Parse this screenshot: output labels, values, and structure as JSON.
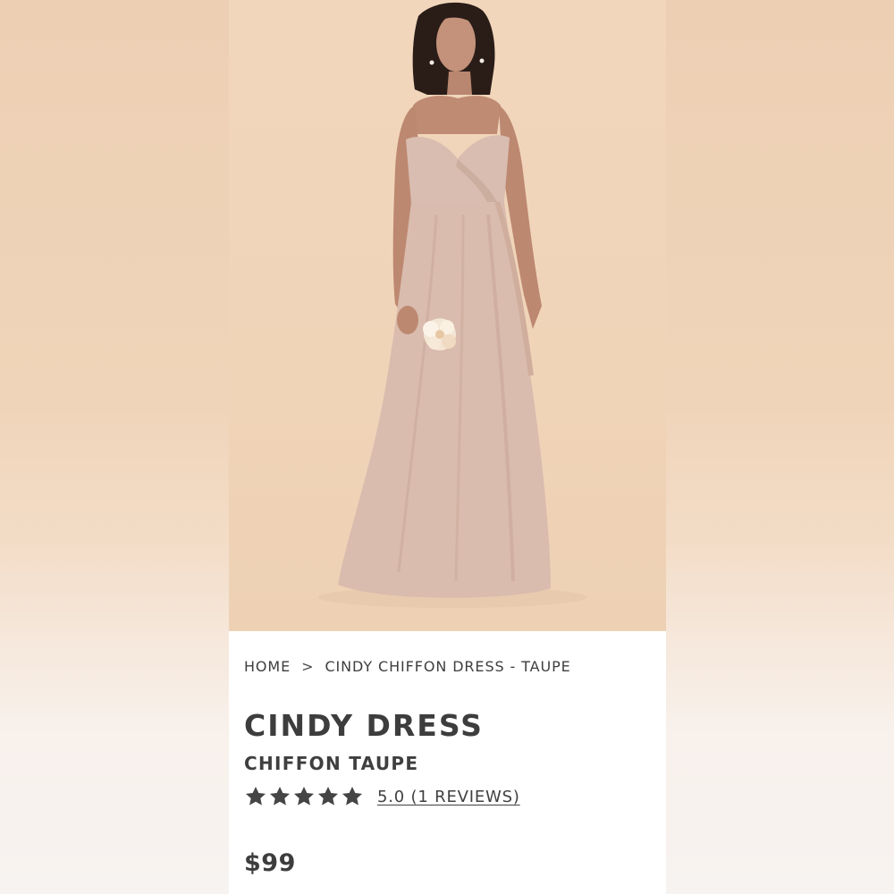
{
  "breadcrumb": {
    "home": "HOME",
    "separator": ">",
    "current": "CINDY CHIFFON DRESS - TAUPE"
  },
  "product": {
    "title": "CINDY DRESS",
    "subtitle": "CHIFFON TAUPE",
    "rating": {
      "stars": 5,
      "max_stars": 5,
      "reviews_label": "5.0 (1 REVIEWS)"
    },
    "price": "$99"
  },
  "colors": {
    "backdrop": "#efd3b7",
    "dress": "#d9bcae",
    "text": "#3d3d3d",
    "star": "#454545"
  }
}
